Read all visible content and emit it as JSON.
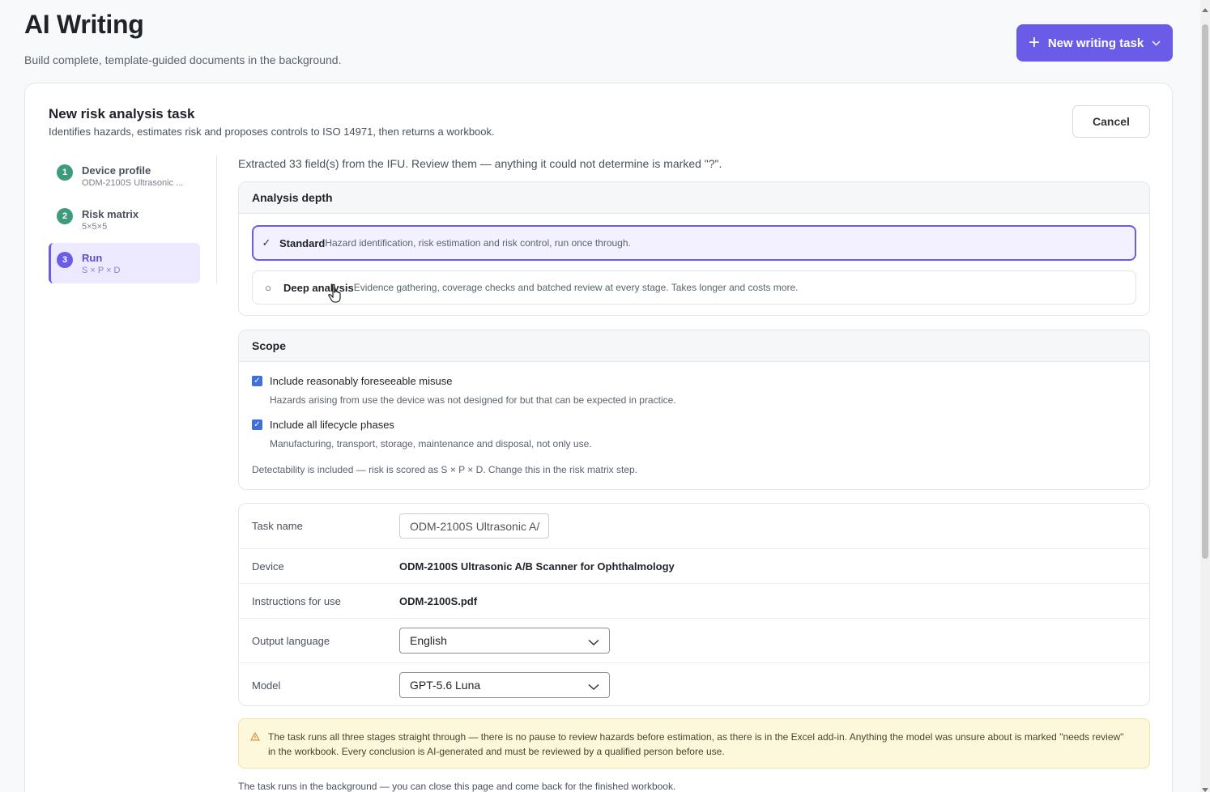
{
  "header": {
    "title": "AI Writing",
    "subtitle": "Build complete, template-guided documents in the background.",
    "new_task_label": "New writing task"
  },
  "task": {
    "title": "New risk analysis task",
    "description": "Identifies hazards, estimates risk and proposes controls to ISO 14971, then returns a workbook.",
    "cancel_label": "Cancel"
  },
  "steps": [
    {
      "num": "1",
      "label": "Device profile",
      "sub": "ODM-2100S Ultrasonic ...",
      "status": "done"
    },
    {
      "num": "2",
      "label": "Risk matrix",
      "sub": "5×5×5",
      "status": "done"
    },
    {
      "num": "3",
      "label": "Run",
      "sub": "S × P × D",
      "status": "active"
    }
  ],
  "extract_note": "Extracted 33 field(s) from the IFU. Review them — anything it could not determine is marked \"?\".",
  "analysis_depth": {
    "heading": "Analysis depth",
    "options": [
      {
        "mark": "✓",
        "name": "Standard",
        "desc": "Hazard identification, risk estimation and risk control, run once through.",
        "selected": true
      },
      {
        "mark": "○",
        "name": "Deep analysis",
        "desc": "Evidence gathering, coverage checks and batched review at every stage. Takes longer and costs more.",
        "selected": false
      }
    ]
  },
  "scope": {
    "heading": "Scope",
    "items": [
      {
        "label": "Include reasonably foreseeable misuse",
        "desc": "Hazards arising from use the device was not designed for but that can be expected in practice.",
        "checked": true
      },
      {
        "label": "Include all lifecycle phases",
        "desc": "Manufacturing, transport, storage, maintenance and disposal, not only use.",
        "checked": true
      }
    ],
    "note": "Detectability is included — risk is scored as S × P × D. Change this in the risk matrix step."
  },
  "form": {
    "task_name_label": "Task name",
    "task_name_value": "ODM-2100S Ultrasonic A/",
    "device_label": "Device",
    "device_value": "ODM-2100S Ultrasonic A/B Scanner for Ophthalmology",
    "ifu_label": "Instructions for use",
    "ifu_value": "ODM-2100S.pdf",
    "language_label": "Output language",
    "language_value": "English",
    "model_label": "Model",
    "model_value": "GPT-5.6 Luna"
  },
  "warning": "The task runs all three stages straight through — there is no pause to review hazards before estimation, as there is in the Excel add-in. Anything the model was unsure about is marked \"needs review\" in the workbook. Every conclusion is AI-generated and must be reviewed by a qualified person before use.",
  "background_note": "The task runs in the background — you can close this page and come back for the finished workbook.",
  "colors": {
    "accent": "#6b5ce7",
    "done": "#3b9b7c",
    "warning_bg": "#fdf8dc"
  }
}
